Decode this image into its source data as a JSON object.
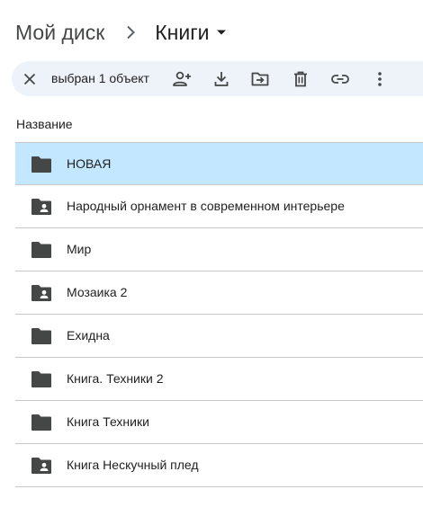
{
  "breadcrumb": {
    "root": "Мой диск",
    "separator_icon": "chevron-right-icon",
    "current": "Книги",
    "current_menu_icon": "caret-down-icon"
  },
  "selection_toolbar": {
    "clear_icon": "close-icon",
    "count_text": "выбран 1 объект",
    "actions": [
      "share-add-person-icon",
      "download-icon",
      "move-to-folder-icon",
      "trash-icon",
      "link-icon",
      "more-vert-icon"
    ]
  },
  "table": {
    "column_name": "Название",
    "rows": [
      {
        "name": "НОВАЯ",
        "icon": "folder-icon",
        "shared": false,
        "selected": true
      },
      {
        "name": "Народный орнамент в современном интерьере",
        "icon": "shared-folder-icon",
        "shared": true,
        "selected": false
      },
      {
        "name": "Мир",
        "icon": "folder-icon",
        "shared": false,
        "selected": false
      },
      {
        "name": "Мозаика 2",
        "icon": "shared-folder-icon",
        "shared": true,
        "selected": false
      },
      {
        "name": "Ехидна",
        "icon": "folder-icon",
        "shared": false,
        "selected": false
      },
      {
        "name": "Книга. Техники 2",
        "icon": "folder-icon",
        "shared": false,
        "selected": false
      },
      {
        "name": "Книга Техники",
        "icon": "folder-icon",
        "shared": false,
        "selected": false
      },
      {
        "name": "Книга Нескучный плед",
        "icon": "shared-folder-icon",
        "shared": true,
        "selected": false
      }
    ]
  },
  "colors": {
    "selected_row": "#c2e7ff",
    "toolbar_bg": "#eef2f9",
    "icon": "#444746",
    "divider": "#c7c7c7"
  }
}
